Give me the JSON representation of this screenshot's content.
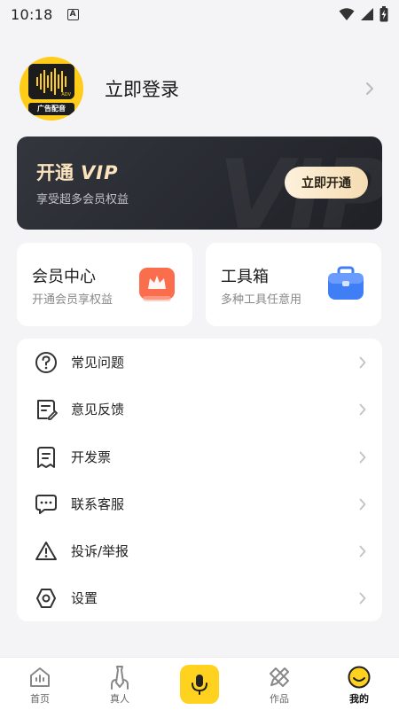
{
  "status_bar": {
    "time": "10:18",
    "notification_letter": "A"
  },
  "profile": {
    "login_text": "立即登录",
    "avatar_label": "广告配音",
    "avatar_badge": "ADV"
  },
  "vip": {
    "title_cn": "开通",
    "title_vip": "VIP",
    "subtitle": "享受超多会员权益",
    "button_label": "立即开通",
    "watermark": "VIP"
  },
  "cards": [
    {
      "title": "会员中心",
      "subtitle": "开通会员享权益",
      "icon": "crown-icon"
    },
    {
      "title": "工具箱",
      "subtitle": "多种工具任意用",
      "icon": "toolbox-icon"
    }
  ],
  "menu": [
    {
      "label": "常见问题",
      "icon": "question-icon"
    },
    {
      "label": "意见反馈",
      "icon": "feedback-icon"
    },
    {
      "label": "开发票",
      "icon": "invoice-icon"
    },
    {
      "label": "联系客服",
      "icon": "chat-icon"
    },
    {
      "label": "投诉/举报",
      "icon": "warning-icon"
    },
    {
      "label": "设置",
      "icon": "settings-icon"
    }
  ],
  "nav": [
    {
      "label": "首页",
      "icon": "home-icon"
    },
    {
      "label": "真人",
      "icon": "person-tie-icon"
    },
    {
      "label": "",
      "icon": "mic-icon"
    },
    {
      "label": "作品",
      "icon": "pencil-ruler-icon"
    },
    {
      "label": "我的",
      "icon": "smiley-icon",
      "active": true
    }
  ],
  "colors": {
    "accent": "#ffd21f",
    "vip_gold": "#fbe3bd",
    "background": "#f4f4f6"
  }
}
